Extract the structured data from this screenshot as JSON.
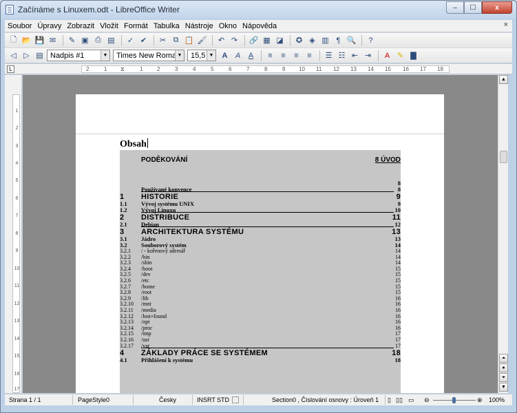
{
  "window": {
    "title": "Začínáme s Linuxem.odt - LibreOffice Writer",
    "minimize": "–",
    "maximize": "☐",
    "close": "x"
  },
  "menu": [
    "Soubor",
    "Úpravy",
    "Zobrazit",
    "Vložit",
    "Formát",
    "Tabulka",
    "Nástroje",
    "Okno",
    "Nápověda"
  ],
  "menu_close": "×",
  "format_bar": {
    "paragraph_style": "Nadpis #1",
    "font_name": "Times New Roman",
    "font_size": "15,5"
  },
  "ruler": {
    "h_ticks": [
      "2",
      "1",
      "1",
      "2",
      "3",
      "4",
      "5",
      "6",
      "7",
      "8",
      "9",
      "10",
      "11",
      "12",
      "13",
      "14",
      "15",
      "16",
      "17",
      "18"
    ],
    "v_ticks": [
      "1",
      "2",
      "3",
      "4",
      "5",
      "6",
      "7",
      "8",
      "9",
      "10",
      "11",
      "12",
      "13",
      "14",
      "15",
      "16",
      "17"
    ]
  },
  "document": {
    "heading": "Obsah",
    "toc": [
      {
        "kind": "h0",
        "num": "",
        "title": "PODĚKOVÁNÍ",
        "page": "8 ÚVOD"
      },
      {
        "kind": "plain",
        "num": "",
        "title": "",
        "page": "8"
      },
      {
        "kind": "plain",
        "num": "",
        "title": "Používané konvence",
        "page": "8"
      },
      {
        "kind": "h1",
        "num": "1",
        "title": "HISTORIE",
        "page": "9"
      },
      {
        "kind": "h2",
        "num": "1.1",
        "title": "Vývoj systému UNIX",
        "page": "9"
      },
      {
        "kind": "h2",
        "num": "1.2",
        "title": "Vývoj Linuxu",
        "page": "10"
      },
      {
        "kind": "h1",
        "num": "2",
        "title": "DISTRIBUCE",
        "page": "11"
      },
      {
        "kind": "h2",
        "num": "2.1",
        "title": "Debian",
        "page": "12"
      },
      {
        "kind": "h1",
        "num": "3",
        "title": "ARCHITEKTURA SYSTÉMU",
        "page": "13"
      },
      {
        "kind": "h2",
        "num": "3.1",
        "title": "Jádro",
        "page": "13"
      },
      {
        "kind": "h2",
        "num": "3.2",
        "title": "Souborový systém",
        "page": "14"
      },
      {
        "kind": "h3",
        "num": "3.2.1",
        "title": "/ - kořenový adresář",
        "page": "14"
      },
      {
        "kind": "h3",
        "num": "3.2.2",
        "title": "/bin",
        "page": "14"
      },
      {
        "kind": "h3",
        "num": "3.2.3",
        "title": "/sbin",
        "page": "14"
      },
      {
        "kind": "h3",
        "num": "3.2.4",
        "title": "/boot",
        "page": "15"
      },
      {
        "kind": "h3",
        "num": "3.2.5",
        "title": "/dev",
        "page": "15"
      },
      {
        "kind": "h3",
        "num": "3.2.6",
        "title": "/etc",
        "page": "15"
      },
      {
        "kind": "h3",
        "num": "3.2.7",
        "title": "/home",
        "page": "15"
      },
      {
        "kind": "h3",
        "num": "3.2.8",
        "title": "/root",
        "page": "15"
      },
      {
        "kind": "h3",
        "num": "3.2.9",
        "title": "/lib",
        "page": "16"
      },
      {
        "kind": "h3",
        "num": "3.2.10",
        "title": "/mnt",
        "page": "16"
      },
      {
        "kind": "h3",
        "num": "3.2.11",
        "title": "/media",
        "page": "16"
      },
      {
        "kind": "h3",
        "num": "3.2.12",
        "title": "/lost+found",
        "page": "16"
      },
      {
        "kind": "h3",
        "num": "3.2.13",
        "title": "/opt",
        "page": "16"
      },
      {
        "kind": "h3",
        "num": "3.2.14",
        "title": "/proc",
        "page": "16"
      },
      {
        "kind": "h3",
        "num": "3.2.15",
        "title": "/tmp",
        "page": "17"
      },
      {
        "kind": "h3",
        "num": "3.2.16",
        "title": "/usr",
        "page": "17"
      },
      {
        "kind": "h3",
        "num": "3.2.17",
        "title": "/var",
        "page": "17"
      },
      {
        "kind": "h1",
        "num": "4",
        "title": "ZÁKLADY PRÁCE SE SYSTÉMEM",
        "page": "18"
      },
      {
        "kind": "h2",
        "num": "4.1",
        "title": "Přihlášení k systému",
        "page": "18"
      }
    ]
  },
  "status": {
    "page": "Strana 1 / 1",
    "page_style": "PageStyle0",
    "language": "Česky",
    "insert_mode": "INSRT",
    "selection_mode": "STD",
    "section": "Section0 , Číslování osnovy : Úroveň 1",
    "zoom": "100%"
  }
}
